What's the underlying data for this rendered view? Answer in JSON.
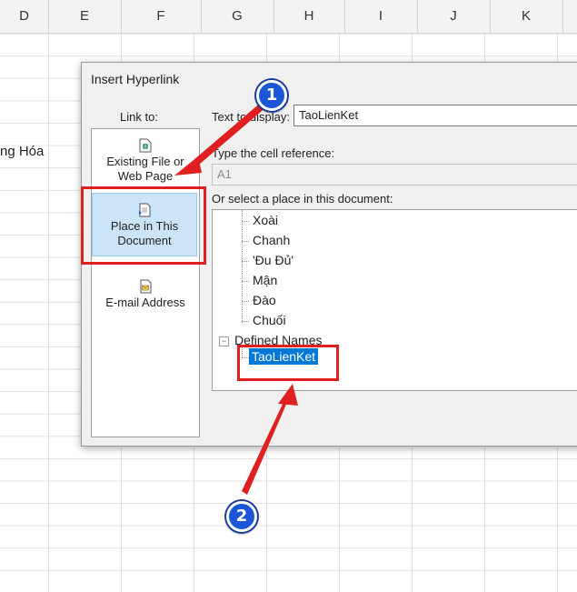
{
  "spreadsheet": {
    "columns": [
      "D",
      "E",
      "F",
      "G",
      "H",
      "I",
      "J",
      "K"
    ],
    "partial_cell_text": "ng Hóa"
  },
  "dialog": {
    "title": "Insert Hyperlink",
    "link_to_label": "Link to:",
    "link_to_items": [
      {
        "line1": "Existing File or",
        "line2": "Web Page",
        "icon": "file-globe-icon"
      },
      {
        "line1": "Place in This",
        "line2": "Document",
        "icon": "document-place-icon",
        "selected": true
      },
      {
        "line1": "E-mail Address",
        "line2": "",
        "icon": "email-icon"
      }
    ],
    "text_to_display_label": "Text to display:",
    "text_to_display_value": "TaoLienKet",
    "cell_reference_label": "Type the cell reference:",
    "cell_reference_value": "A1",
    "place_label": "Or select a place in this document:",
    "tree_items": [
      "Xoài",
      "Chanh",
      "'Đu Đủ'",
      "Mận",
      "Đào",
      "Chuối"
    ],
    "defined_names_label": "Defined Names",
    "defined_name_item": "TaoLienKet"
  },
  "annotations": {
    "badge1": "1",
    "badge2": "2",
    "highlight_color": "#e02020",
    "badge_color": "#1a56d6"
  }
}
